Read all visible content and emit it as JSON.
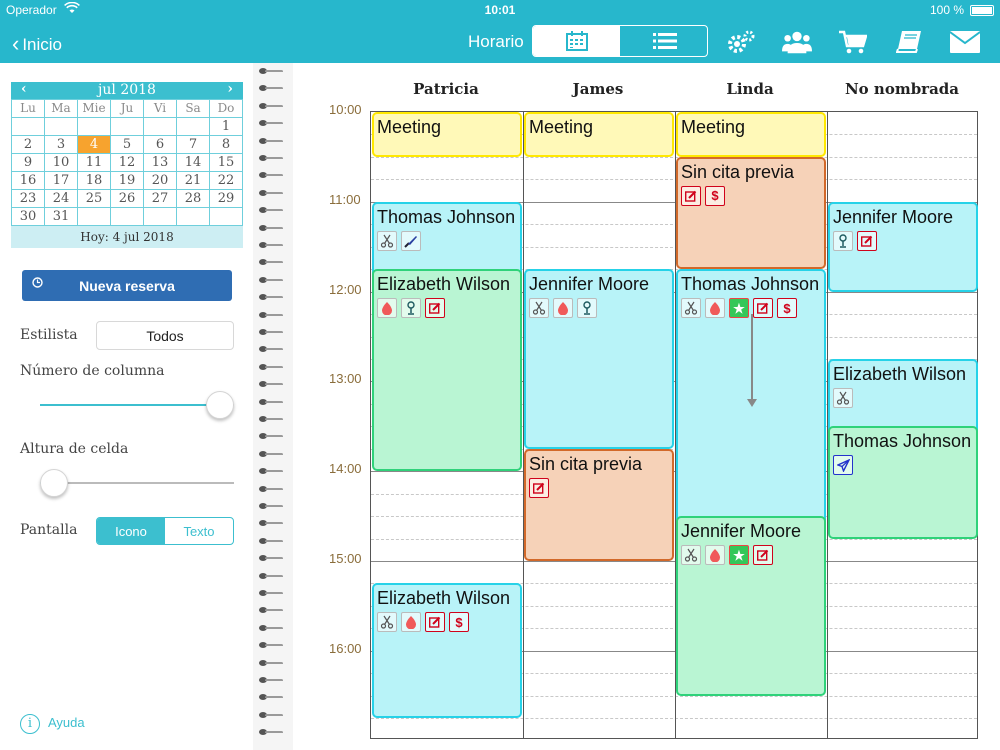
{
  "status": {
    "carrier": "Operador",
    "time": "10:01",
    "battery": "100 %"
  },
  "nav": {
    "back_label": "Inicio",
    "title": "Horario"
  },
  "calendar": {
    "month_label": "jul 2018",
    "weekdays": [
      "Lu",
      "Ma",
      "Mie",
      "Ju",
      "Vi",
      "Sa",
      "Do"
    ],
    "days": [
      "",
      "",
      "",
      "",
      "",
      "",
      "1",
      "2",
      "3",
      "4",
      "5",
      "6",
      "7",
      "8",
      "9",
      "10",
      "11",
      "12",
      "13",
      "14",
      "15",
      "16",
      "17",
      "18",
      "19",
      "20",
      "21",
      "22",
      "23",
      "24",
      "25",
      "26",
      "27",
      "28",
      "29",
      "30",
      "31",
      "",
      "",
      "",
      "",
      ""
    ],
    "selected_day": "4",
    "today_label": "Hoy: 4 jul 2018"
  },
  "new_booking_label": "Nueva reserva",
  "settings": {
    "stylist_label": "Estilista",
    "stylist_value": "Todos",
    "columns_label": "Número de columna",
    "columns_level": 1.0,
    "cell_height_label": "Altura de celda",
    "cell_height_level": 0.0,
    "display_label": "Pantalla",
    "display_options": [
      "Icono",
      "Texto"
    ],
    "display_selected": "Icono"
  },
  "help_label": "Ayuda",
  "columns": [
    "Patricia",
    "James",
    "Linda",
    "No nombrada"
  ],
  "times": [
    "10:00",
    "11:00",
    "12:00",
    "13:00",
    "14:00",
    "15:00",
    "16:00"
  ],
  "appointments": [
    {
      "id": "a1",
      "col": 0,
      "start": "10:00",
      "end": "10:30",
      "name": "Meeting",
      "color": "yellow",
      "icons": []
    },
    {
      "id": "a2",
      "col": 1,
      "start": "10:00",
      "end": "10:30",
      "name": "Meeting",
      "color": "yellow",
      "icons": []
    },
    {
      "id": "a3",
      "col": 2,
      "start": "10:00",
      "end": "10:30",
      "name": "Meeting",
      "color": "yellow",
      "icons": []
    },
    {
      "id": "a4",
      "col": 2,
      "start": "10:30",
      "end": "11:45",
      "name": "Sin cita previa",
      "color": "orange",
      "icons": [
        "edit-icon",
        "dollar-icon"
      ]
    },
    {
      "id": "a5",
      "col": 0,
      "start": "11:00",
      "end": "12:00",
      "name": "Thomas Johnson",
      "color": "cyan",
      "icons": [
        "scissors-icon",
        "brush-icon"
      ]
    },
    {
      "id": "a6",
      "col": 3,
      "start": "11:00",
      "end": "12:00",
      "name": "Jennifer Moore",
      "color": "cyan",
      "icons": [
        "dryer-icon",
        "edit-icon"
      ]
    },
    {
      "id": "a7",
      "col": 0,
      "start": "11:45",
      "end": "14:00",
      "name": "Elizabeth Wilson",
      "color": "mint",
      "icons": [
        "color-drop-icon",
        "dryer-icon",
        "edit-icon"
      ]
    },
    {
      "id": "a8",
      "col": 1,
      "start": "11:45",
      "end": "13:45",
      "name": "Jennifer Moore",
      "color": "cyan",
      "icons": [
        "scissors-icon",
        "color-drop-icon",
        "dryer-icon"
      ]
    },
    {
      "id": "a9",
      "col": 2,
      "start": "11:45",
      "end": "14:45",
      "name": "Thomas Johnson",
      "color": "cyan",
      "icons": [
        "scissors-icon",
        "color-drop-icon",
        "star-icon",
        "edit-icon",
        "dollar-icon"
      ]
    },
    {
      "id": "a10",
      "col": 3,
      "start": "12:45",
      "end": "13:45",
      "name": "Elizabeth Wilson",
      "color": "cyan",
      "icons": [
        "scissors-icon"
      ]
    },
    {
      "id": "a11",
      "col": 3,
      "start": "13:30",
      "end": "14:45",
      "name": "Thomas Johnson",
      "color": "mint",
      "icons": [
        "send-icon"
      ]
    },
    {
      "id": "a12",
      "col": 1,
      "start": "13:45",
      "end": "15:00",
      "name": "Sin cita previa",
      "color": "orange",
      "icons": [
        "edit-icon"
      ]
    },
    {
      "id": "a13",
      "col": 2,
      "start": "14:30",
      "end": "16:30",
      "name": "Jennifer Moore",
      "color": "mint",
      "icons": [
        "scissors-icon",
        "color-drop-icon",
        "star-icon",
        "edit-icon"
      ]
    },
    {
      "id": "a14",
      "col": 0,
      "start": "15:15",
      "end": "16:45",
      "name": "Elizabeth Wilson",
      "color": "cyan",
      "icons": [
        "scissors-icon",
        "color-drop-icon",
        "edit-icon",
        "dollar-icon"
      ]
    }
  ]
}
